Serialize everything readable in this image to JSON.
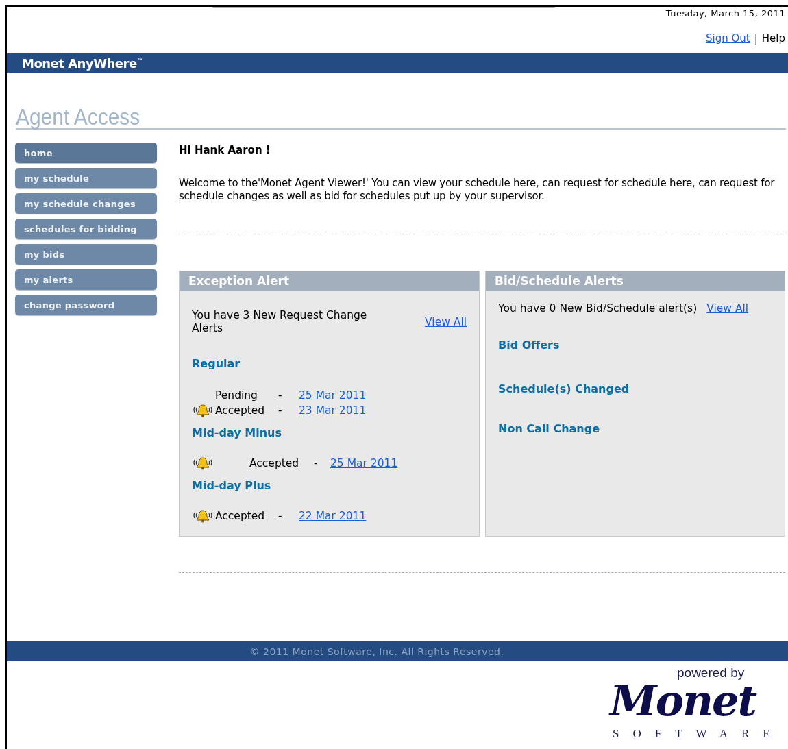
{
  "header": {
    "date": "Tuesday, March 15, 2011",
    "links": [
      {
        "label": "Sign Out",
        "kind": "link"
      },
      {
        "label": "|",
        "kind": "separator"
      },
      {
        "label": "Help",
        "kind": "text"
      }
    ]
  },
  "title_bar": {
    "title": "Monet AnyWhere",
    "mark": "™"
  },
  "page_heading": "Agent Access",
  "sidebar": {
    "items": [
      {
        "label": "home",
        "selected": true
      },
      {
        "label": "my schedule",
        "selected": false
      },
      {
        "label": "my schedule changes",
        "selected": false
      },
      {
        "label": "schedules for bidding",
        "selected": false
      },
      {
        "label": "my bids",
        "selected": false
      },
      {
        "label": "my alerts",
        "selected": false
      },
      {
        "label": "change password",
        "selected": false
      }
    ]
  },
  "greeting": "Hi Hank Aaron !",
  "welcome": "Welcome to the'Monet Agent Viewer!' You can view your schedule here, can request for schedule here, can request for schedule changes as well as bid for schedules put up by your supervisor.",
  "exception_alert": {
    "title": "Exception Alert",
    "summary": "You have 3 New Request Change Alerts",
    "view_all": "View All",
    "groups": [
      {
        "name": "Regular",
        "rows": [
          {
            "bell": false,
            "status": "Pending",
            "dash": "-",
            "date": "25 Mar 2011"
          },
          {
            "bell": true,
            "status": "Accepted",
            "dash": "-",
            "date": "23 Mar 2011"
          }
        ]
      },
      {
        "name": "Mid-day Minus",
        "rows": [
          {
            "bell": true,
            "status": "Accepted",
            "dash": "-",
            "date": "25 Mar 2011"
          }
        ]
      },
      {
        "name": "Mid-day Plus",
        "rows": [
          {
            "bell": true,
            "status": "Accepted",
            "dash": "-",
            "date": "22 Mar 2011"
          }
        ]
      }
    ]
  },
  "bid_alerts": {
    "title": "Bid/Schedule Alerts",
    "summary": "You have 0 New Bid/Schedule alert(s)",
    "view_all": "View All",
    "sections": [
      "Bid Offers",
      "Schedule(s) Changed",
      "Non Call Change"
    ]
  },
  "footer": {
    "copyright": "© 2011 Monet Software, Inc. All Rights Reserved."
  },
  "logo": {
    "tagline": "powered by",
    "name": "Monet",
    "subtitle": "SOFTWARE"
  }
}
